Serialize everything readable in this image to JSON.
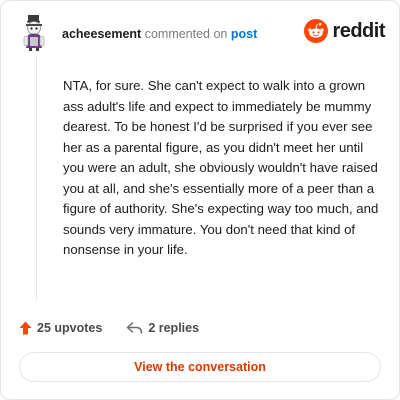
{
  "comment": {
    "author": "acheesement",
    "action": "commented on",
    "target": "post",
    "body": "NTA, for sure. She can't expect to walk into a grown ass adult's life and expect to immediately be mummy dearest. To be honest I'd be surprised if you ever see her as a parental figure, as you didn't meet her until you were an adult, she obviously wouldn't have raised you at all, and she's essentially more of a peer than a figure of authority. She's expecting way too much, and sounds very immature. You don't need that kind of nonsense in your life.",
    "upvotes_label": "25 upvotes",
    "replies_label": "2 replies"
  },
  "brand": {
    "wordmark": "reddit",
    "color": "#ff4500"
  },
  "cta": {
    "label": "View the conversation",
    "color": "#d93a00"
  },
  "icons": {
    "avatar": "snoo-avatar-icon",
    "brand": "reddit-logo-icon",
    "upvote": "upvote-arrow-icon",
    "reply": "reply-arrow-icon"
  }
}
